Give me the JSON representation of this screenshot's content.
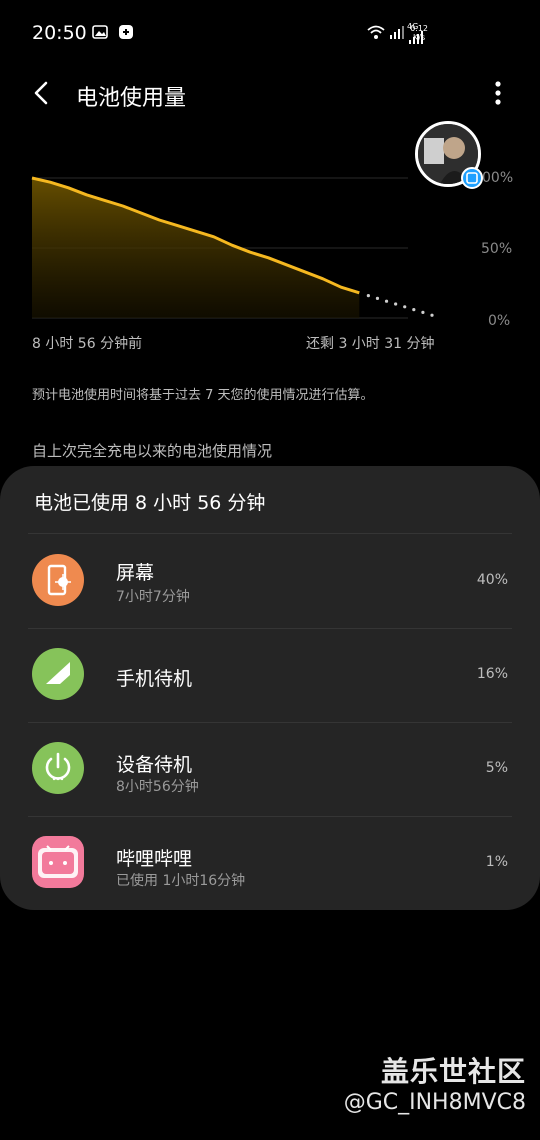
{
  "status_bar": {
    "time": "20:50",
    "network_speed": "0.12",
    "network_unit": "K/s",
    "signal_label": "4G"
  },
  "header": {
    "title": "电池使用量"
  },
  "chart": {
    "y_ticks": [
      "00%",
      "50%",
      "0%"
    ],
    "x_start": "8 小时 56 分钟前",
    "x_end": "还剩 3 小时 31 分钟"
  },
  "chart_data": {
    "type": "line",
    "ylim": [
      0,
      100
    ],
    "y_tick_values": [
      0,
      50,
      100
    ],
    "series": [
      {
        "values": [
          100,
          97,
          93,
          88,
          84,
          80,
          75,
          70,
          66,
          62,
          58,
          52,
          47,
          43,
          38,
          33,
          28,
          22,
          18
        ]
      },
      {
        "style": "projected-dotted",
        "values": [
          18,
          14,
          10,
          6,
          2
        ]
      }
    ],
    "colors": {
      "line": "#f5b820",
      "fill": "#6b5200"
    }
  },
  "note": "预计电池使用时间将基于过去 7 天您的使用情况进行估算。",
  "section_title": "自上次完全充电以来的电池使用情况",
  "card": {
    "summary": "电池已使用 8 小时 56 分钟",
    "items": [
      {
        "name": "屏幕",
        "sub": "7小时7分钟",
        "pct": "40%",
        "icon": "screen-icon",
        "color": "#ef8a4f"
      },
      {
        "name": "手机待机",
        "sub": "",
        "pct": "16%",
        "icon": "signal-icon",
        "color": "#86c35a"
      },
      {
        "name": "设备待机",
        "sub": "8小时56分钟",
        "pct": "5%",
        "icon": "power-icon",
        "color": "#86c35a"
      },
      {
        "name": "哔哩哔哩",
        "sub": "已使用 1小时16分钟",
        "pct": "1%",
        "icon": "bilibili-icon",
        "color": "#f27a9b"
      }
    ]
  },
  "watermark": {
    "title": "盖乐世社区",
    "user": "@GC_INH8MVC8"
  }
}
